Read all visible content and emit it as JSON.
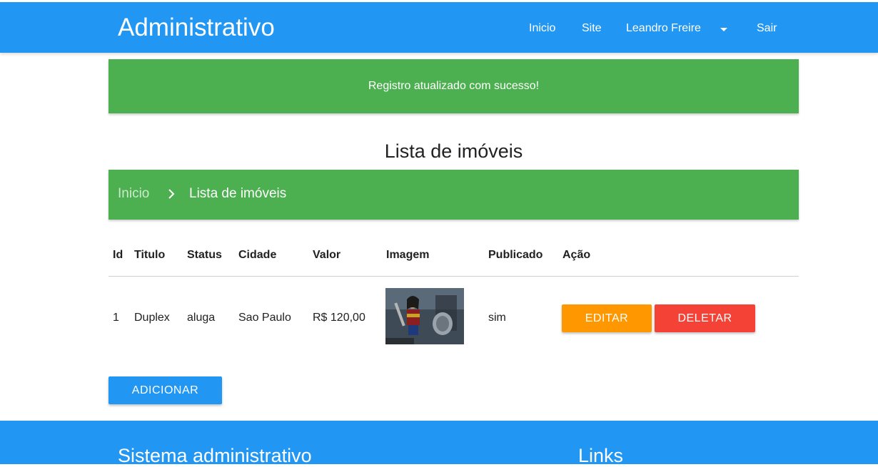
{
  "header": {
    "brand": "Administrativo",
    "nav": {
      "inicio": "Inicio",
      "site": "Site",
      "user": "Leandro Freire",
      "sair": "Sair"
    }
  },
  "alert": {
    "message": "Registro atualizado com sucesso!"
  },
  "page": {
    "title": "Lista de imóveis"
  },
  "breadcrumb": {
    "home": "Inicio",
    "current": "Lista de imóveis"
  },
  "table": {
    "columns": {
      "id": "Id",
      "titulo": "Titulo",
      "status": "Status",
      "cidade": "Cidade",
      "valor": "Valor",
      "imagem": "Imagem",
      "publicado": "Publicado",
      "acao": "Ação"
    },
    "rows": [
      {
        "id": "1",
        "titulo": "Duplex",
        "status": "aluga",
        "cidade": "Sao Paulo",
        "valor": "R$ 120,00",
        "publicado": "sim",
        "edit_label": "EDITAR",
        "delete_label": "DELETAR"
      }
    ]
  },
  "actions": {
    "add_label": "ADICIONAR"
  },
  "footer": {
    "title": "Sistema administrativo",
    "links_title": "Links"
  },
  "colors": {
    "primary": "#2196f3",
    "success": "#4caf50",
    "warning": "#ff9800",
    "danger": "#f44336"
  },
  "icons": {
    "dropdown": "caret-down-icon",
    "breadcrumb_separator": "chevron-right-icon"
  }
}
